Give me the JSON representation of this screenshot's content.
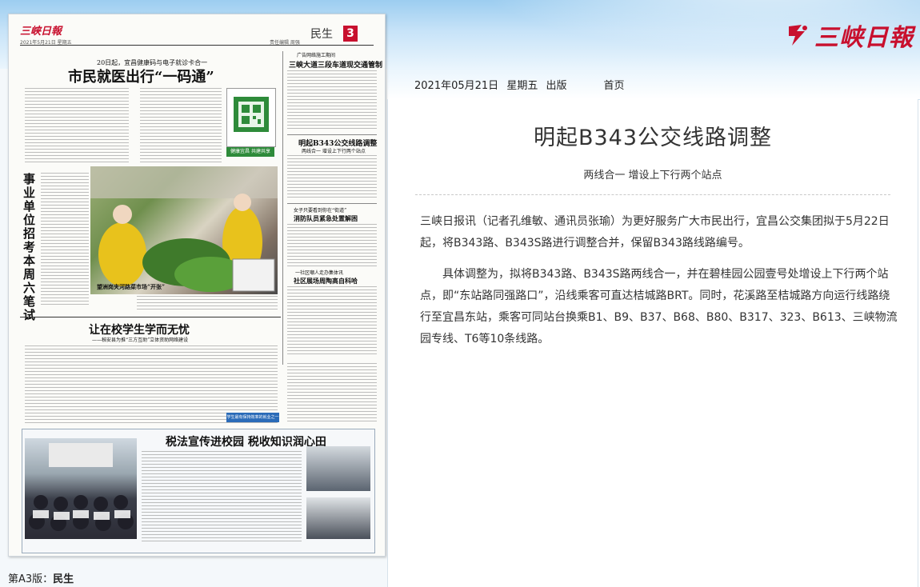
{
  "header": {
    "logo_text": "三峡日報"
  },
  "infobar": {
    "date": "2021年05月21日",
    "weekday": "星期五",
    "edition": "出版",
    "home_label": "首页"
  },
  "page_label": {
    "prefix": "第A3版：",
    "section": "民生"
  },
  "newspaper": {
    "logo": "三峡日報",
    "date_line": "2021年5月21日 星期五",
    "editor_line": "责任编辑 周强",
    "section": "民生",
    "page_num": "3",
    "kicker1": "20日起，宜昌健康码与电子就诊卡合一",
    "headline1": "市民就医出行“一码通”",
    "headline_v": "事业单位招考本周六笔试",
    "kicker2": "广告网络施工期间",
    "headline2": "三峡大道三段车道现交通管制",
    "headline3": "明起B343公交线路调整",
    "headline3_sub": "两线合一 增设上下行两个站点",
    "kicker4": "女子只要看到你在“街道”",
    "headline4": "消防队员紧急处置解困",
    "kicker5": "一社区嘲人走办集体讯",
    "headline5": "社区展场周陶高自科哈",
    "headline6": "让在校学生学而无忧",
    "headline6_sub": "——秭安县为推“三方互助”立体资助网络建设",
    "headline7": "税法宣传进校园 税收知识润心田",
    "caption1": "望洲岗夹河路菜市场“开张”",
    "badge1": "健康宜昌 共建共享",
    "badge2": "学生最有保持效率的就业之一"
  },
  "article": {
    "title": "明起B343公交线路调整",
    "subtitle": "两线合一 增设上下行两个站点",
    "paragraphs": [
      "三峡日报讯（记者孔维敏、通讯员张瑜）为更好服务广大市民出行，宜昌公交集团拟于5月22日起，将B343路、B343S路进行调整合并，保留B343路线路编号。",
      "具体调整为，拟将B343路、B343S路两线合一，并在碧桂园公园壹号处增设上下行两个站点，即“东站路同强路口”，沿线乘客可直达桔城路BRT。同时，花溪路至桔城路方向运行线路绕行至宜昌东站，乘客可同站台换乘B1、B9、B37、B68、B80、B317、323、B613、三峡物流园专线、T6等10条线路。"
    ]
  },
  "colors": {
    "brand_red": "#c8102e",
    "banner_blue": "#9ccdf0"
  }
}
